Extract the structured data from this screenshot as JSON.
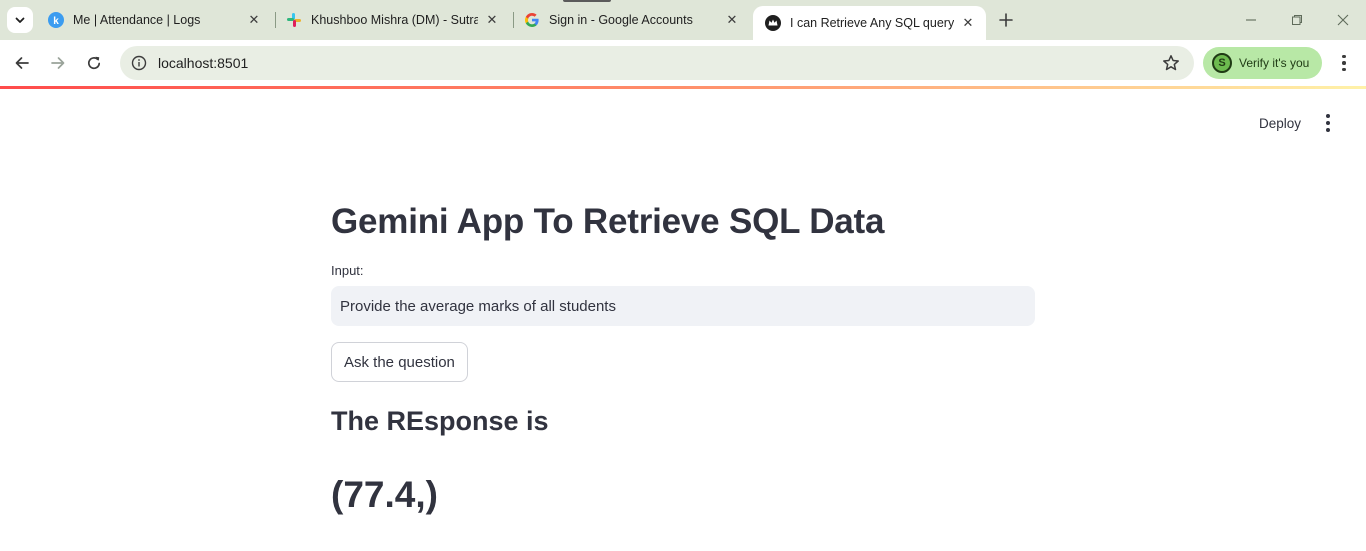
{
  "browser": {
    "tabs": [
      {
        "title": "Me | Attendance | Logs",
        "favicon": "keka-k-icon",
        "active": false
      },
      {
        "title": "Khushboo Mishra (DM) - Sutra...",
        "favicon": "slack-icon",
        "active": false
      },
      {
        "title": "Sign in - Google Accounts",
        "favicon": "google-g-icon",
        "active": false
      },
      {
        "title": "I can Retrieve Any SQL query",
        "favicon": "streamlit-crown-icon",
        "active": true
      }
    ],
    "url": "localhost:8501",
    "verify_label": "Verify it's you"
  },
  "app": {
    "deploy_label": "Deploy",
    "title": "Gemini App To Retrieve SQL Data",
    "input_label": "Input:",
    "input_value": "Provide the average marks of all students",
    "button_label": "Ask the question",
    "response_heading": "The REsponse is",
    "response_value": "(77.4,)"
  },
  "colors": {
    "tab_strip": "#dfe6d8",
    "omnibox": "#e9eee4",
    "verify_chip": "#b8e8a6",
    "streamlit_accent": "#ff4b4b",
    "text_primary": "#31333f",
    "input_bg": "#f0f2f6"
  }
}
